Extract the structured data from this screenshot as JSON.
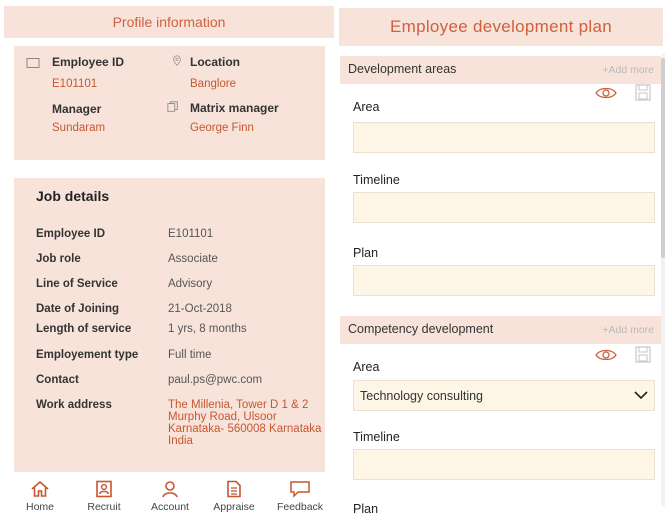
{
  "left": {
    "header_title": "Profile information",
    "profile": {
      "employee_id_label": "Employee ID",
      "employee_id_value": "E101101",
      "location_label": "Location",
      "location_value": "Banglore",
      "manager_label": "Manager",
      "manager_value": "Sundaram",
      "matrix_manager_label": "Matrix manager",
      "matrix_manager_value": "George Finn"
    },
    "job": {
      "title": "Job details",
      "rows": [
        {
          "label": "Employee ID",
          "value": "E101101"
        },
        {
          "label": "Job role",
          "value": "Associate"
        },
        {
          "label": "Line of Service",
          "value": "Advisory"
        },
        {
          "label": "Date of Joining",
          "value": "21-Oct-2018"
        },
        {
          "label": "Length of service",
          "value": "1 yrs, 8 months"
        },
        {
          "label": "Employement type",
          "value": "Full time"
        },
        {
          "label": "Contact",
          "value": "paul.ps@pwc.com"
        },
        {
          "label": "Work address",
          "value": "The Millenia, Tower D 1 & 2 Murphy Road, Ulsoor Karnataka- 560008 Karnataka India"
        }
      ]
    },
    "nav": [
      {
        "label": "Home",
        "icon": "home-icon"
      },
      {
        "label": "Recruit",
        "icon": "recruit-icon"
      },
      {
        "label": "Account",
        "icon": "account-icon"
      },
      {
        "label": "Appraise",
        "icon": "appraise-icon"
      },
      {
        "label": "Feedback",
        "icon": "feedback-icon"
      }
    ]
  },
  "right": {
    "header_title": "Employee development plan",
    "dev_areas": {
      "title": "Development areas",
      "add_more": "+Add more",
      "area_label": "Area",
      "area_value": "",
      "timeline_label": "Timeline",
      "timeline_value": "",
      "plan_label": "Plan",
      "plan_value": ""
    },
    "competency": {
      "title": "Competency development",
      "add_more": "+Add more",
      "area_label": "Area",
      "area_selected": "Technology consulting",
      "timeline_label": "Timeline",
      "timeline_value": "",
      "plan_label": "Plan"
    }
  },
  "colors": {
    "accent": "#d0603d",
    "panel_bg": "#f8e3db",
    "field_bg": "#fdf5e6"
  }
}
